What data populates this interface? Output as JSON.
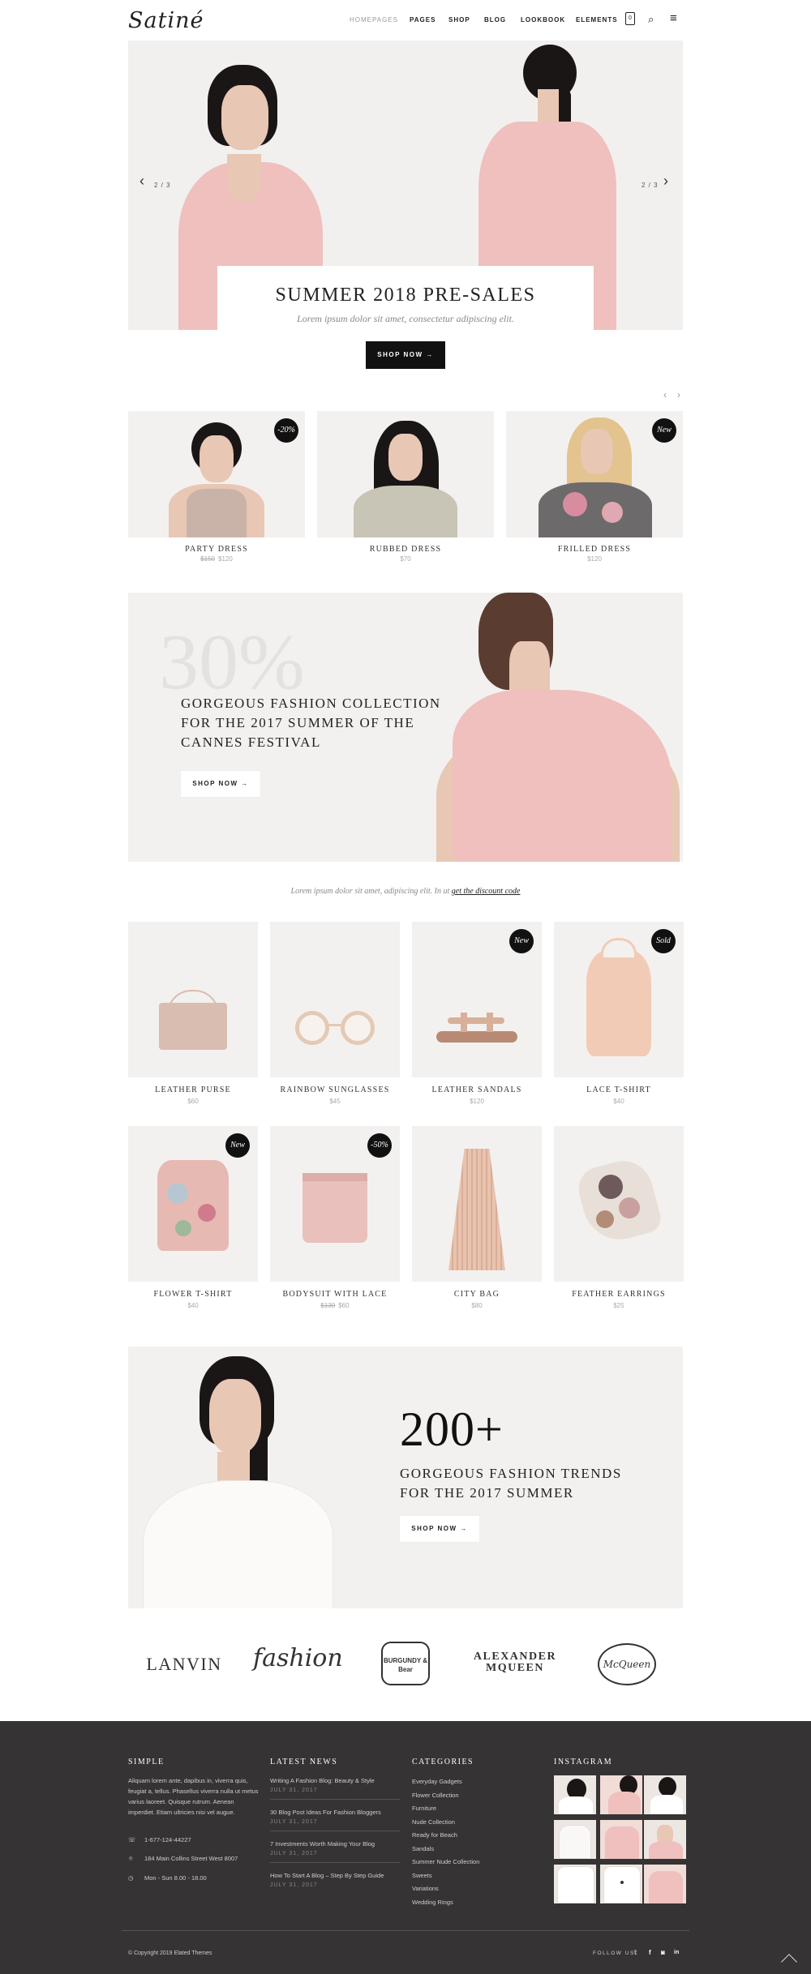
{
  "header": {
    "logo": "Satiné",
    "nav": [
      "HOMEPAGES",
      "PAGES",
      "SHOP",
      "BLOG",
      "LOOKBOOK",
      "ELEMENTS"
    ],
    "cart_count": "0",
    "icons": [
      "cart-icon",
      "search-icon",
      "menu-icon"
    ]
  },
  "hero": {
    "counter_left": "2 / 3",
    "counter_right": "2 / 3",
    "title": "SUMMER 2018 PRE-SALES",
    "subtitle": "Lorem ipsum dolor sit amet, consectetur adipiscing elit.",
    "button": "SHOP NOW →"
  },
  "featured": [
    {
      "name": "PARTY DRESS",
      "old_price": "$150",
      "price": "$120",
      "badge": "-20%"
    },
    {
      "name": "RUBBED DRESS",
      "old_price": "",
      "price": "$70",
      "badge": ""
    },
    {
      "name": "FRILLED DRESS",
      "old_price": "",
      "price": "$120",
      "badge": "New"
    }
  ],
  "promo": {
    "big": "30%",
    "lines": [
      "GORGEOUS FASHION COLLECTION",
      "FOR THE 2017 SUMMER OF THE",
      "CANNES FESTIVAL"
    ],
    "button": "SHOP NOW →"
  },
  "discount": {
    "text": "Lorem ipsum dolor sit amet, adipiscing elit. In ut",
    "link": "get the discount code"
  },
  "products": [
    {
      "name": "LEATHER PURSE",
      "old_price": "",
      "price": "$60",
      "badge": ""
    },
    {
      "name": "RAINBOW SUNGLASSES",
      "old_price": "",
      "price": "$45",
      "badge": ""
    },
    {
      "name": "LEATHER SANDALS",
      "old_price": "",
      "price": "$120",
      "badge": "New"
    },
    {
      "name": "LACE T-SHIRT",
      "old_price": "",
      "price": "$40",
      "badge": "Sold"
    },
    {
      "name": "FLOWER T-SHIRT",
      "old_price": "",
      "price": "$40",
      "badge": "New"
    },
    {
      "name": "BODYSUIT WITH LACE",
      "old_price": "$130",
      "price": "$60",
      "badge": "-50%"
    },
    {
      "name": "CITY BAG",
      "old_price": "",
      "price": "$80",
      "badge": ""
    },
    {
      "name": "FEATHER EARRINGS",
      "old_price": "",
      "price": "$25",
      "badge": ""
    }
  ],
  "trends": {
    "big": "200+",
    "lines": [
      "GORGEOUS FASHION TRENDS",
      "FOR THE 2017 SUMMER"
    ],
    "button": "SHOP NOW →"
  },
  "brands": [
    "LANVIN",
    "fashion",
    "BURGUNDY & Bear",
    "ALEXANDER MQUEEN",
    "McQueen"
  ],
  "footer": {
    "simple": {
      "title": "SIMPLE",
      "text": "Aliquam lorem ante, dapibus in, viverra quis, feugiat a, tellus. Phasellus viverra nulla ut metus varius laoreet. Quisque rutrum. Aenean imperdiet. Etiam ultricies nisi vel augue.",
      "phone": "1-677-124-44227",
      "address": "184 Main Collins Street West 8007",
      "hours": "Mon - Sun 8.00 - 18.00"
    },
    "news": {
      "title": "LATEST NEWS",
      "items": [
        {
          "title": "Writing A Fashion Blog: Beauty & Style",
          "date": "JULY 31, 2017"
        },
        {
          "title": "30 Blog Post Ideas For Fashion Bloggers",
          "date": "JULY 31, 2017"
        },
        {
          "title": "7 Investments Worth Making Your Blog",
          "date": "JULY 31, 2017"
        },
        {
          "title": "How To Start A Blog – Step By Step Guide",
          "date": "JULY 31, 2017"
        }
      ]
    },
    "categories": {
      "title": "CATEGORIES",
      "items": [
        "Everyday Gadgets",
        "Flower Collection",
        "Furniture",
        "Nude Collection",
        "Ready for Beach",
        "Sandals",
        "Summer Nude Collection",
        "Sweets",
        "Variations",
        "Wedding Rings"
      ]
    },
    "instagram": {
      "title": "INSTAGRAM"
    },
    "copyright": "© Copyright 2019 Elated Themes",
    "follow": "FOLLOW US"
  },
  "colors": {
    "accent": "#111111",
    "footer_bg": "#353333",
    "panel_bg": "#f3f1ef"
  }
}
